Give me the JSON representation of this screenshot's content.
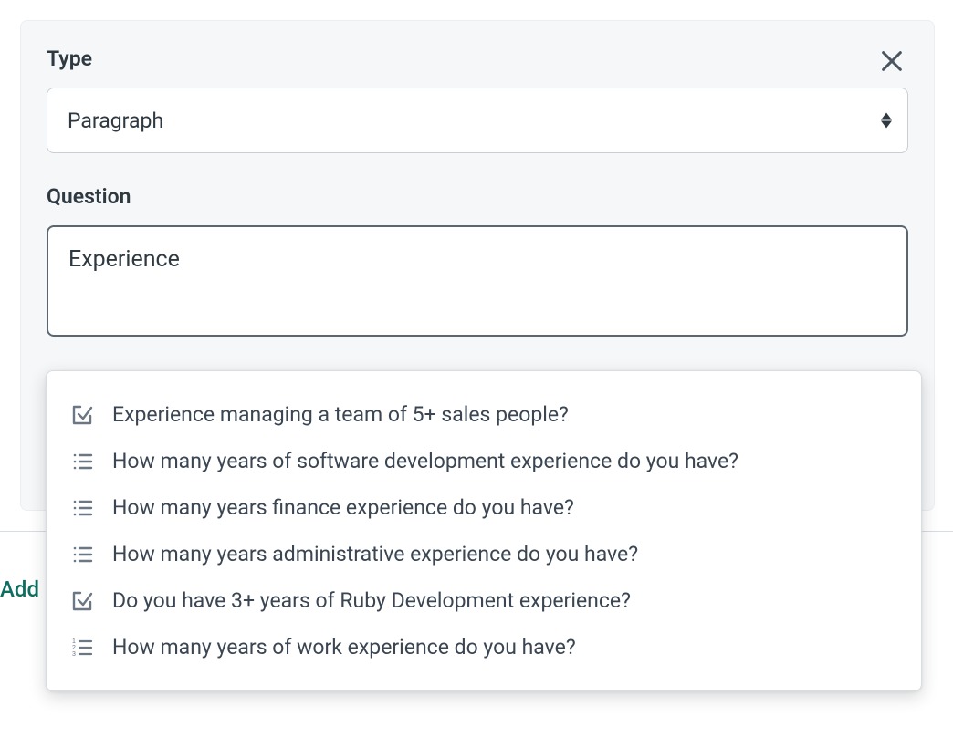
{
  "panel": {
    "type_label": "Type",
    "type_value": "Paragraph",
    "question_label": "Question",
    "question_value": "Experience"
  },
  "add_link_text": "Add",
  "suggestions": [
    {
      "icon": "check-square",
      "text": "Experience managing a team of 5+ sales people?"
    },
    {
      "icon": "bullet-list",
      "text": "How many years of software development experience do you have?"
    },
    {
      "icon": "bullet-list",
      "text": "How many years finance experience do you have?"
    },
    {
      "icon": "bullet-list",
      "text": "How many years administrative experience do you have?"
    },
    {
      "icon": "check-square",
      "text": "Do you have 3+ years of Ruby Development experience?"
    },
    {
      "icon": "number-list",
      "text": "How many years of work experience do you have?"
    }
  ]
}
